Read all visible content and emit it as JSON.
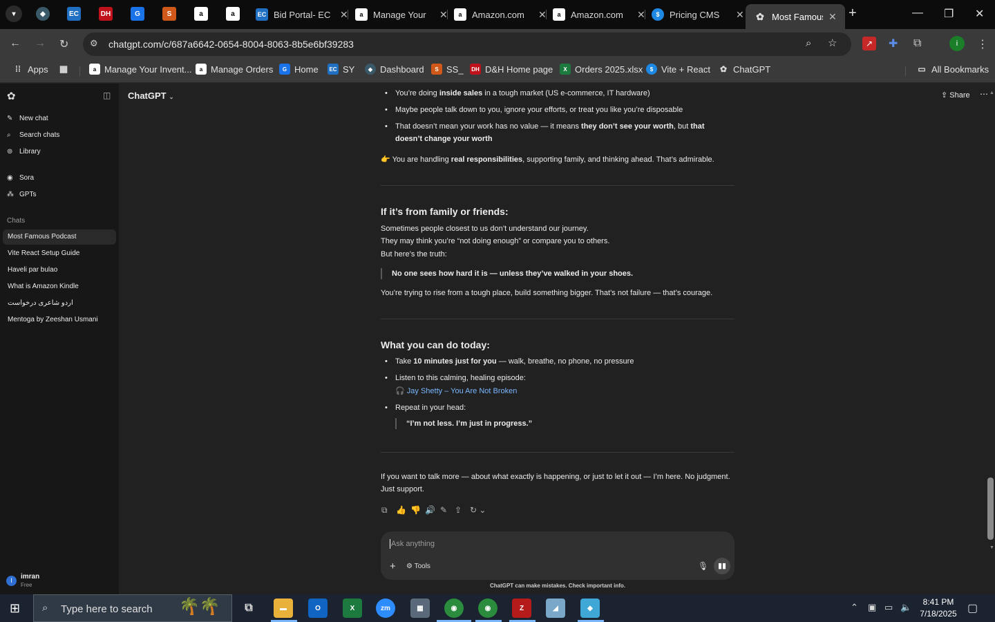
{
  "browser": {
    "tabs": [
      {
        "title": "Bid Portal- EC",
        "favicon": "ec-icon"
      },
      {
        "title": "Manage Your",
        "favicon": "amazon-icon"
      },
      {
        "title": "Amazon.com",
        "favicon": "amazon-icon"
      },
      {
        "title": "Amazon.com",
        "favicon": "amazon-icon"
      },
      {
        "title": "Pricing CMS",
        "favicon": "dollar-icon"
      },
      {
        "title": "Most Famous",
        "favicon": "chatgpt-icon",
        "active": true
      }
    ],
    "pinned_tab_favicons": [
      "chevron-down-icon",
      "app-icon",
      "ec-icon",
      "dh-icon",
      "g-icon",
      "stack-icon",
      "amazon-icon",
      "amazon-icon"
    ],
    "url": "chatgpt.com/c/687a6642-0654-8004-8063-8b5e6bf39283",
    "bookmarks": [
      {
        "label": "Apps"
      },
      {
        "label": "Manage Your Invent..."
      },
      {
        "label": "Manage Orders"
      },
      {
        "label": "Home"
      },
      {
        "label": "SY"
      },
      {
        "label": "Dashboard"
      },
      {
        "label": "SS_"
      },
      {
        "label": "D&H Home page"
      },
      {
        "label": "Orders 2025.xlsx"
      },
      {
        "label": "Vite + React"
      },
      {
        "label": "ChatGPT"
      }
    ],
    "all_bookmarks": "All Bookmarks"
  },
  "sidebar": {
    "nav": [
      {
        "label": "New chat",
        "icon": "edit-icon"
      },
      {
        "label": "Search chats",
        "icon": "search-icon"
      },
      {
        "label": "Library",
        "icon": "library-icon"
      }
    ],
    "extras": [
      {
        "label": "Sora",
        "icon": "sora-icon"
      },
      {
        "label": "GPTs",
        "icon": "grid-icon"
      }
    ],
    "chats_heading": "Chats",
    "chats": [
      {
        "label": "Most Famous Podcast",
        "active": true
      },
      {
        "label": "Vite React Setup Guide"
      },
      {
        "label": "Haveli par bulao"
      },
      {
        "label": "What is Amazon Kindle"
      },
      {
        "label": "اردو شاعری درخواست"
      },
      {
        "label": "Mentoga by Zeeshan Usmani"
      }
    ],
    "user": {
      "name": "imran",
      "plan": "Free",
      "initial": "I"
    }
  },
  "header": {
    "model": "ChatGPT",
    "share": "Share"
  },
  "message": {
    "bullets_top": [
      {
        "pre": "You’re doing ",
        "bold": "inside sales",
        "post": " in a tough market (US e-commerce, IT hardware)"
      },
      {
        "pre": "Maybe people talk down to you, ignore your efforts, or treat you like you’re disposable",
        "bold": "",
        "post": ""
      },
      {
        "pre": "That doesn’t mean your work has no value — it means ",
        "bold": "they don’t see your worth",
        "post": ", but ",
        "bold2": "that doesn’t change your worth"
      }
    ],
    "pointer_line": {
      "pre": "You are handling ",
      "bold": "real responsibilities",
      "post": ", supporting family, and thinking ahead. That’s admirable."
    },
    "section2_heading": "If it’s from family or friends:",
    "section2_lines": [
      "Sometimes people closest to us don’t understand our journey.",
      "They may think you’re “not doing enough” or compare you to others.",
      "But here’s the truth:"
    ],
    "section2_quote": "No one sees how hard it is — unless they’ve walked in your shoes.",
    "section2_after": "You’re trying to rise from a tough place, build something bigger. That’s not failure — that’s courage.",
    "section3_heading": "What you can do today:",
    "section3_b1": {
      "pre": "Take ",
      "bold": "10 minutes just for you",
      "post": " — walk, breathe, no phone, no pressure"
    },
    "section3_b2": "Listen to this calming, healing episode:",
    "section3_link": "Jay Shetty – You Are Not Broken",
    "section3_b3": "Repeat in your head:",
    "section3_quote": "“I’m not less. I’m just in progress.”",
    "closing_1": "If you want to talk more — about what exactly is happening, or just to let it out — I’m here. No judgment.",
    "closing_2": "Just support."
  },
  "composer": {
    "placeholder": "Ask anything",
    "tools": "Tools"
  },
  "disclaimer": "ChatGPT can make mistakes. Check important info.",
  "taskbar": {
    "search_placeholder": "Type here to search",
    "time": "8:41 PM",
    "date": "7/18/2025",
    "apps": [
      "task-view-icon",
      "file-explorer-icon",
      "outlook-icon",
      "excel-icon",
      "zoom-icon",
      "calculator-icon",
      "chrome-icon",
      "chrome-icon",
      "filezilla-icon",
      "app-icon",
      "app-icon"
    ]
  }
}
